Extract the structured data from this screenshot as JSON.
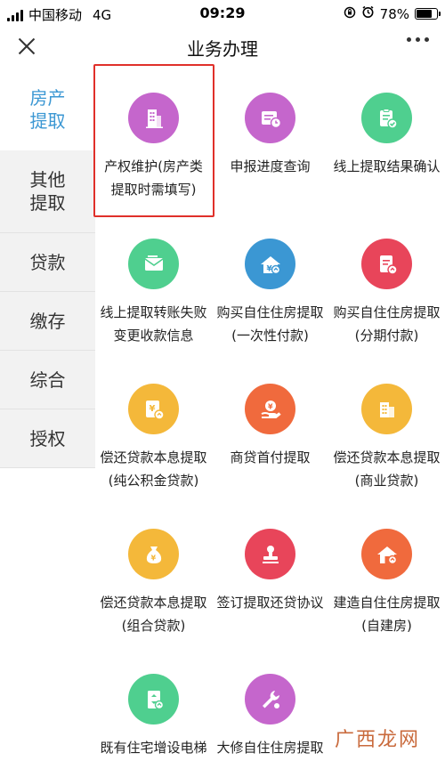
{
  "status_bar": {
    "carrier": "中国移动",
    "network": "4G",
    "time": "09:29",
    "battery": "78%",
    "battery_level": 0.78
  },
  "nav": {
    "title": "业务办理",
    "close_icon": "close-icon",
    "more_icon": "more-icon"
  },
  "sidebar": {
    "items": [
      {
        "label": "房产提取",
        "active": true
      },
      {
        "label": "其他提取",
        "active": false
      },
      {
        "label": "贷款",
        "active": false
      },
      {
        "label": "缴存",
        "active": false
      },
      {
        "label": "综合",
        "active": false
      },
      {
        "label": "授权",
        "active": false
      }
    ]
  },
  "grid": {
    "items": [
      {
        "label": "产权维护(房产类提取时需填写)",
        "icon": "building-icon",
        "color": "#c566cc"
      },
      {
        "label": "申报进度查询",
        "icon": "progress-icon",
        "color": "#c566cc"
      },
      {
        "label": "线上提取结果确认",
        "icon": "clipboard-check-icon",
        "color": "#4fcf8f"
      },
      {
        "label": "线上提取转账失败变更收款信息",
        "icon": "envelope-icon",
        "color": "#4fcf8f"
      },
      {
        "label": "购买自住住房提取(一次性付款)",
        "icon": "house-yuan-icon",
        "color": "#3b97d3"
      },
      {
        "label": "购买自住住房提取(分期付款)",
        "icon": "document-icon",
        "color": "#e8455a"
      },
      {
        "label": "偿还贷款本息提取(纯公积金贷款)",
        "icon": "yuan-note-icon",
        "color": "#f4b83a"
      },
      {
        "label": "商贷首付提取",
        "icon": "hand-coin-icon",
        "color": "#f06a3d"
      },
      {
        "label": "偿还贷款本息提取(商业贷款)",
        "icon": "building-doc-icon",
        "color": "#f4b83a"
      },
      {
        "label": "偿还贷款本息提取(组合贷款)",
        "icon": "money-bag-icon",
        "color": "#f4b83a"
      },
      {
        "label": "签订提取还贷协议",
        "icon": "stamp-icon",
        "color": "#e8455a"
      },
      {
        "label": "建造自住住房提取(自建房)",
        "icon": "house-build-icon",
        "color": "#f06a3d"
      },
      {
        "label": "既有住宅增设电梯提取",
        "icon": "elevator-icon",
        "color": "#4fcf8f"
      },
      {
        "label": "大修自住住房提取(大修自住房)",
        "icon": "wrench-icon",
        "color": "#c566cc"
      }
    ]
  },
  "watermark": "广西龙网"
}
